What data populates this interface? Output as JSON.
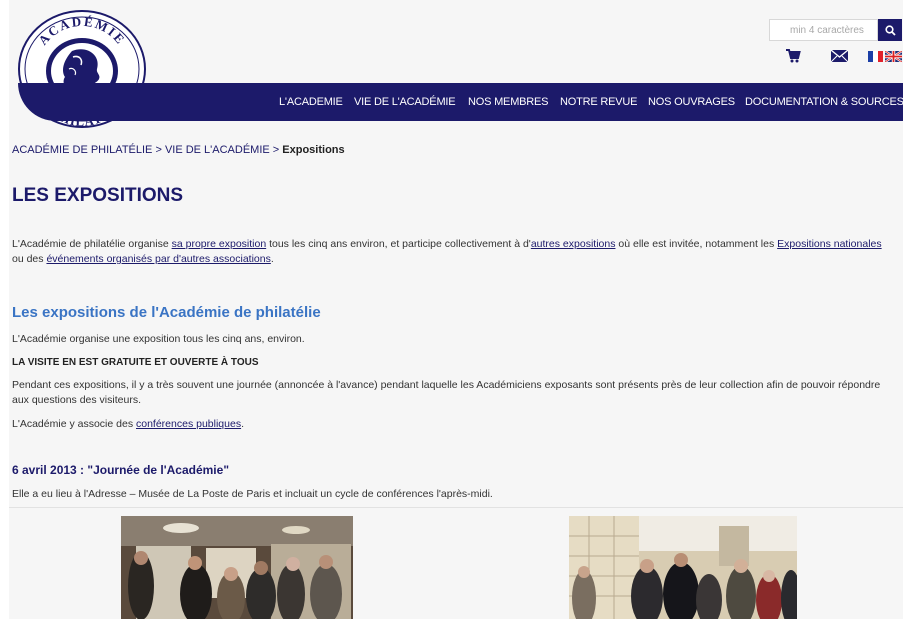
{
  "header": {
    "logo_top_text": "ACADÉMIE",
    "logo_bottom_text": "DE PHILATÉLIE",
    "search_placeholder": "min 4 caractères",
    "icons": [
      "search-icon",
      "cart-icon",
      "mail-icon",
      "flag-fr-icon",
      "flag-uk-icon"
    ]
  },
  "nav": {
    "items": [
      "L'ACADEMIE",
      "VIE DE L'ACADÉMIE",
      "NOS MEMBRES",
      "NOTRE REVUE",
      "NOS OUVRAGES",
      "DOCUMENTATION & SOURCES"
    ]
  },
  "breadcrumb": {
    "home": "ACADÉMIE DE PHILATÉLIE",
    "sep": " > ",
    "parent": "VIE DE L'ACADÉMIE",
    "current": "Expositions"
  },
  "page_title": "LES EXPOSITIONS",
  "intro": {
    "t1": "L'Académie de philatélie organise ",
    "l1": "sa propre exposition",
    "t2": " tous les cinq ans environ, et participe collectivement à d'",
    "l2": "autres expositions",
    "t3": " où elle est invitée, notamment les ",
    "l3": "Expositions nationales",
    "t4": " ou des ",
    "l4": "événements organisés par d'autres associations",
    "t5": "."
  },
  "section": {
    "title": "Les expositions de l'Académie de philatélie",
    "p1": "L'Académie organise une exposition tous les cinq ans, environ.",
    "p2": "LA VISITE EN EST GRATUITE ET OUVERTE À TOUS",
    "p3": "Pendant ces expositions, il y a très souvent une journée (annoncée à l'avance) pendant laquelle les Académiciens exposants sont présents près de leur collection afin de pouvoir répondre aux questions des visiteurs.",
    "p4_text": "L'Académie y associe des ",
    "p4_link": "conférences publiques",
    "p4_end": "."
  },
  "event": {
    "title": "6 avril 2013 : \"Journée de l'Académie\"",
    "desc": "Elle a eu lieu à l'Adresse – Musée de La Poste de Paris et incluait un cycle de conférences l'après-midi."
  },
  "colors": {
    "primary": "#1c1a6a",
    "section_blue": "#3a74c4",
    "background": "#f6f6f6"
  }
}
